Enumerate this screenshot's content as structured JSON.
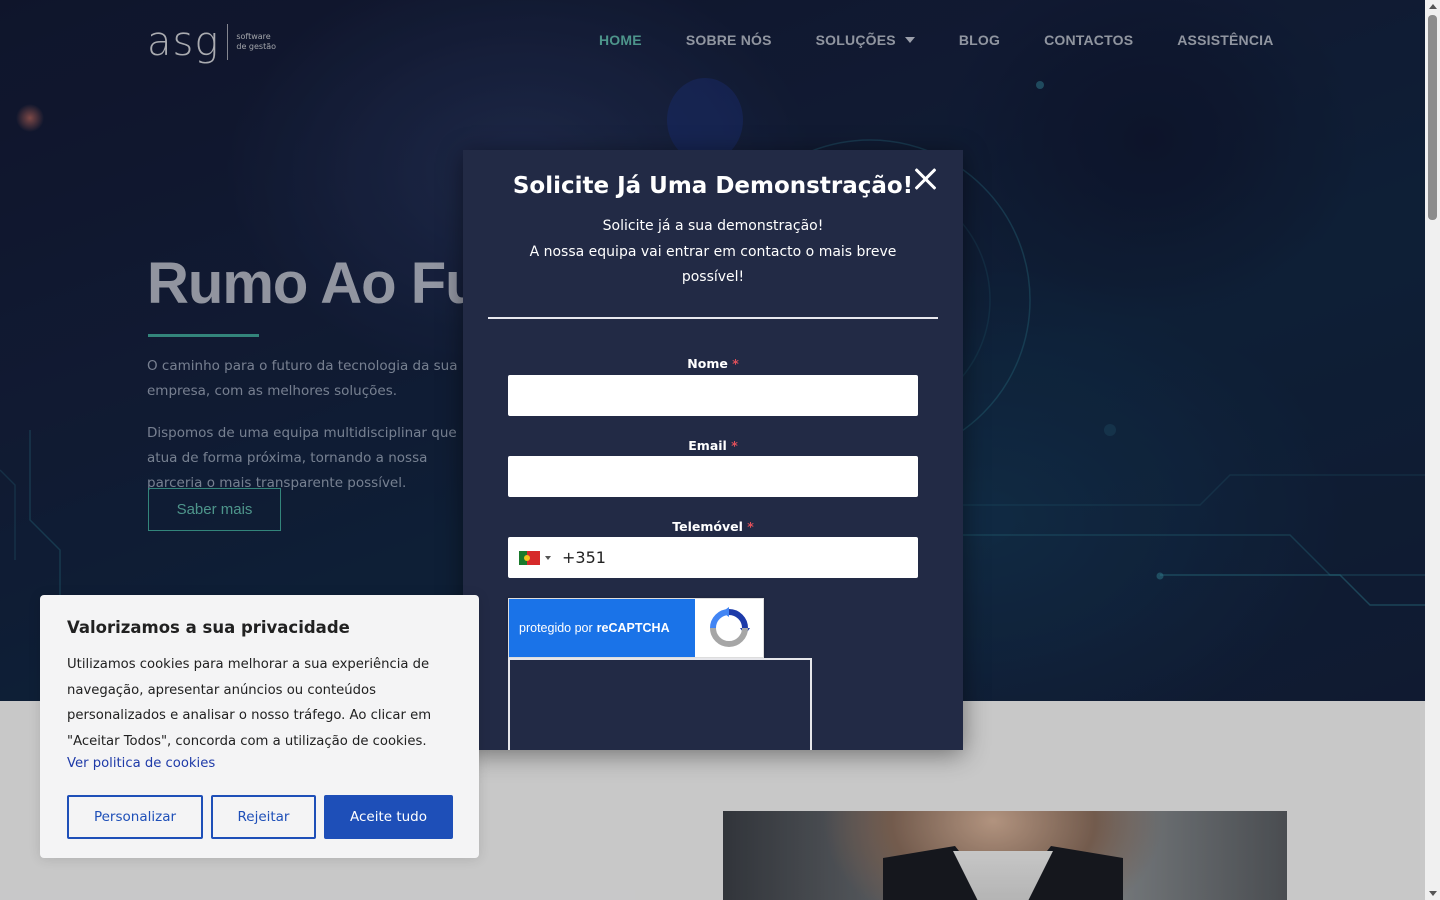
{
  "logo": {
    "wordmark": "asg",
    "tagline_1": "software",
    "tagline_2": "de gestão"
  },
  "nav": {
    "items": [
      {
        "label": "HOME",
        "active": true
      },
      {
        "label": "SOBRE NÓS"
      },
      {
        "label": "SOLUÇÕES",
        "dropdown": true
      },
      {
        "label": "BLOG"
      },
      {
        "label": "CONTACTOS"
      },
      {
        "label": "ASSISTÊNCIA"
      }
    ]
  },
  "hero": {
    "title": "Rumo Ao Futuro",
    "paragraph_1": "O caminho para o futuro da tecnologia da sua empresa, com as melhores soluções.",
    "paragraph_2": "Dispomos de uma equipa multidisciplinar que atua de forma próxima, tornando a nossa parceria o mais transparente possível.",
    "button": "Saber mais"
  },
  "modal": {
    "title": "Solicite Já Uma Demonstração!",
    "subtitle_1": "Solicite já a sua demonstração!",
    "subtitle_2": "A nossa equipa vai entrar em contacto o mais breve possível!",
    "fields": {
      "name_label": "Nome",
      "email_label": "Email",
      "phone_label": "Telemóvel",
      "required_mark": "*",
      "phone_country": "PT",
      "phone_code": "+351"
    },
    "recaptcha": {
      "prefix": "protegido por",
      "brand": "reCAPTCHA"
    }
  },
  "cookie": {
    "title": "Valorizamos a sua privacidade",
    "text": "Utilizamos cookies para melhorar a sua experiência de navegação, apresentar anúncios ou conteúdos personalizados e analisar o nosso tráfego. Ao clicar em \"Aceitar Todos\", concorda com a utilização de cookies.",
    "link": "Ver politica de cookies",
    "buttons": {
      "customize": "Personalizar",
      "reject": "Rejeitar",
      "accept": "Aceite tudo"
    }
  },
  "colors": {
    "accent_teal": "#3fa397",
    "modal_bg": "#222a45",
    "cookie_blue": "#1e4fb8",
    "recaptcha_blue": "#1a73e8",
    "required_red": "#e0505a"
  }
}
